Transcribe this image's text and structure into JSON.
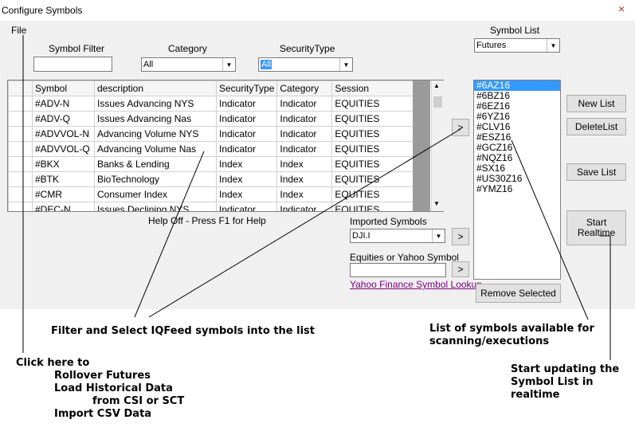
{
  "window": {
    "title": "Configure Symbols",
    "close": "×"
  },
  "menu": {
    "file": "File"
  },
  "filters": {
    "symbol_filter_label": "Symbol Filter",
    "symbol_filter_value": "",
    "category_label": "Category",
    "category_value": "All",
    "security_type_label": "SecurityType",
    "security_type_value": "All"
  },
  "symbol_list": {
    "label": "Symbol List",
    "selected": "Futures",
    "items": [
      "#6AZ16",
      "#6BZ16",
      "#6EZ16",
      "#6YZ16",
      "#CLV16",
      "#ESZ16",
      "#GCZ16",
      "#NQZ16",
      "#SX16",
      "#US30Z16",
      "#YMZ16"
    ],
    "selected_item": "#6AZ16"
  },
  "grid": {
    "columns": [
      "Symbol",
      "description",
      "SecurityType",
      "Category",
      "Session"
    ],
    "rows": [
      [
        "#ADV-N",
        "Issues Advancing NYS",
        "Indicator",
        "Indicator",
        "EQUITIES"
      ],
      [
        "#ADV-Q",
        "Issues Advancing Nas",
        "Indicator",
        "Indicator",
        "EQUITIES"
      ],
      [
        "#ADVVOL-N",
        "Advancing Volume NYS",
        "Indicator",
        "Indicator",
        "EQUITIES"
      ],
      [
        "#ADVVOL-Q",
        "Advancing Volume Nas",
        "Indicator",
        "Indicator",
        "EQUITIES"
      ],
      [
        "#BKX",
        "Banks & Lending",
        "Index",
        "Index",
        "EQUITIES"
      ],
      [
        "#BTK",
        "BioTechnology",
        "Index",
        "Index",
        "EQUITIES"
      ],
      [
        "#CMR",
        "Consumer Index",
        "Index",
        "Index",
        "EQUITIES"
      ],
      [
        "#DEC-N",
        "Issues Declining NYS",
        "Indicator",
        "Indicator",
        "EQUITIES"
      ]
    ]
  },
  "help_text": "Help Off - Press F1 for Help",
  "imported": {
    "label": "Imported Symbols",
    "value": "DJI.I"
  },
  "equities": {
    "label": "Equities or Yahoo Symbol",
    "value": "",
    "link": "Yahoo Finance Symbol Lookup"
  },
  "buttons": {
    "add": ">",
    "add_imported": ">",
    "add_equity": ">",
    "new_list": "New List",
    "delete_list": "DeleteList",
    "save_list": "Save List",
    "start_realtime": "Start Realtime",
    "remove_selected": "Remove Selected"
  },
  "annotations": {
    "filter_select": "Filter and Select IQFeed symbols into the list",
    "list_available_1": "List of symbols available for",
    "list_available_2": "scanning/executions",
    "click_here": "Click here to",
    "rollover": "Rollover Futures",
    "load_hist": "Load Historical Data",
    "from_csi": "from CSI or SCT",
    "import_csv": "Import CSV Data",
    "start_updating_1": "Start updating the",
    "start_updating_2": "Symbol List in",
    "start_updating_3": "realtime"
  }
}
